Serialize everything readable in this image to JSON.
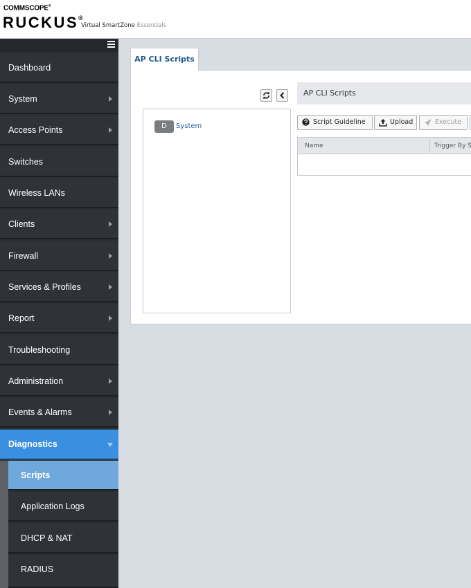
{
  "header": {
    "brand_top": "COMMSCOPE",
    "brand_top_mark": "®",
    "brand_main": "RUCKUS",
    "brand_main_mark": "®",
    "product_name": "Virtual SmartZone",
    "product_edition": "Essentials"
  },
  "sidebar": {
    "toggle_icon": "hamburger-menu-icon",
    "items": [
      {
        "label": "Dashboard"
      },
      {
        "label": "System"
      },
      {
        "label": "Access Points"
      },
      {
        "label": "Switches"
      },
      {
        "label": "Wireless LANs"
      },
      {
        "label": "Clients"
      },
      {
        "label": "Firewall"
      },
      {
        "label": "Services & Profiles"
      },
      {
        "label": "Report"
      },
      {
        "label": "Troubleshooting"
      },
      {
        "label": "Administration"
      },
      {
        "label": "Events & Alarms"
      },
      {
        "label": "Diagnostics"
      }
    ],
    "sub_items": [
      {
        "label": "Scripts"
      },
      {
        "label": "Application Logs"
      },
      {
        "label": "DHCP & NAT"
      },
      {
        "label": "RADIUS"
      }
    ]
  },
  "main": {
    "tab_label": "AP CLI Scripts",
    "tree": {
      "refresh_icon": "refresh-icon",
      "collapse_icon": "chevron-left-icon",
      "node_badge": "D",
      "node_label": "System"
    },
    "section_title": "AP CLI Scripts",
    "toolbar": {
      "guideline_label": "Script Guideline",
      "upload_label": "Upload",
      "execute_label": "Execute"
    },
    "grid": {
      "columns": [
        "Name",
        "Trigger By S"
      ]
    }
  },
  "colors": {
    "sidebar_bg": "#2f3338",
    "active_nav": "#3a8fe0",
    "selected_sub": "#6fa9dc",
    "content_bg": "#d8dde3",
    "tab_text": "#1f5b8a"
  }
}
